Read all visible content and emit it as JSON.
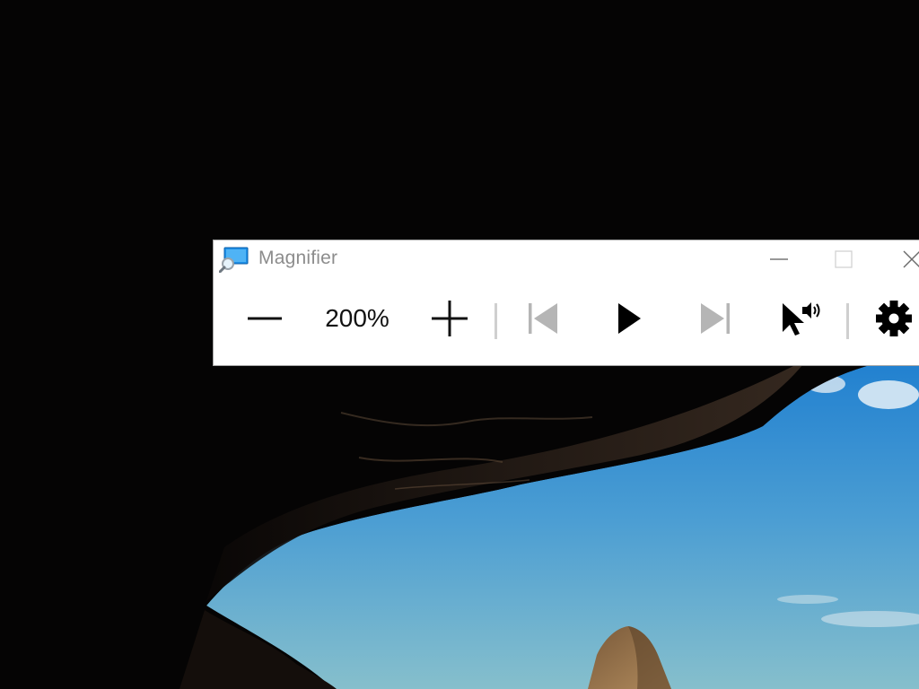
{
  "window": {
    "title": "Magnifier",
    "app_icon": "magnifier-app-icon"
  },
  "caption_buttons": {
    "minimize_icon": "minimize-icon",
    "maximize_icon": "maximize-icon",
    "close_icon": "close-icon"
  },
  "toolbar": {
    "zoom_out_icon": "minus-icon",
    "zoom_level": "200%",
    "zoom_in_icon": "plus-icon",
    "previous_icon": "skip-previous-icon",
    "play_icon": "play-icon",
    "next_icon": "skip-next-icon",
    "read_from_here_icon": "cursor-speaker-icon",
    "settings_icon": "gear-icon"
  },
  "colors": {
    "window_background": "#ffffff",
    "title_text": "#8c8c8c",
    "enabled_icon": "#000000",
    "disabled_icon": "#b5b5b5",
    "separator": "#cfcfcf"
  }
}
